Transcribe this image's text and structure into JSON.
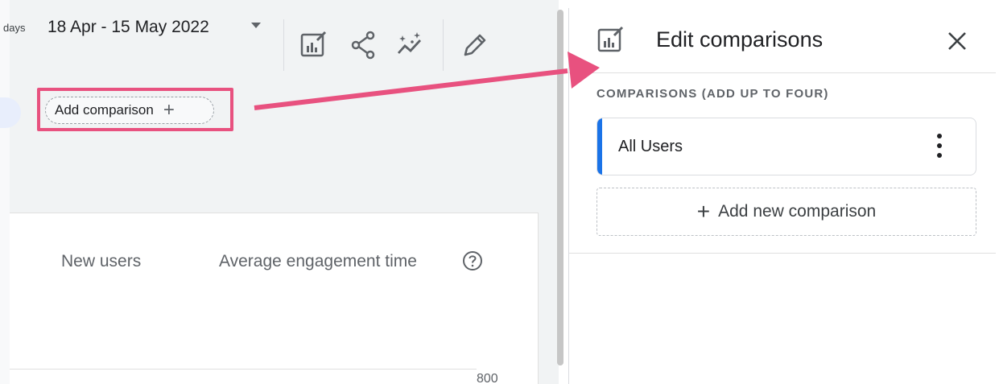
{
  "toolbar": {
    "days_label": "days",
    "date_range": "18 Apr - 15 May 2022"
  },
  "compare": {
    "add_comparison_label": "Add comparison",
    "add_comparison_plus": "+"
  },
  "card": {
    "metrics": [
      "New users",
      "Average engagement time"
    ],
    "axis_value": "800"
  },
  "panel": {
    "title": "Edit comparisons",
    "section_heading": "COMPARISONS (ADD UP TO FOUR)",
    "items": [
      {
        "label": "All Users"
      }
    ],
    "add_new_label": "Add new comparison",
    "add_new_plus": "+"
  },
  "colors": {
    "highlight": "#e8517f",
    "accent_blue": "#1a73e8"
  },
  "icons": [
    "comparison-icon",
    "share-icon",
    "insights-icon",
    "edit-pencil-icon",
    "dropdown-caret-icon",
    "help-icon",
    "close-icon",
    "more-vert-icon",
    "plus-icon"
  ]
}
